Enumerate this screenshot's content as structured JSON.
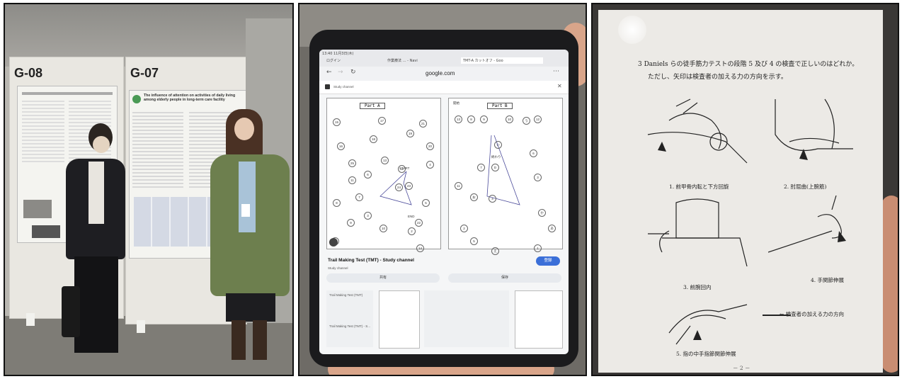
{
  "panel_left": {
    "boards": [
      {
        "label": "G-08"
      },
      {
        "label": "G-07"
      }
    ],
    "poster_title": "The influence of attention on activities of daily living among elderly people in long-term care facility"
  },
  "panel_middle": {
    "browser": {
      "time": "13:40  11月3日(木)",
      "tabs": [
        "ログイン",
        "作業療法 … - Navi",
        "TMT-A カットオフ - Goo"
      ],
      "url": "google.com",
      "channel_bar": "Study channel"
    },
    "sheets": [
      {
        "label": "Part A",
        "numbers": [
          "15",
          "17",
          "21",
          "16",
          "19",
          "13",
          "12",
          "6",
          "4",
          "23",
          "5",
          "24",
          "8",
          "7",
          "3",
          "9",
          "10",
          "2",
          "1",
          "14",
          "25",
          "11",
          "20",
          "22",
          "18"
        ],
        "start_text": "START",
        "end_text": "END"
      },
      {
        "label": "Part B",
        "numbers": [
          "13",
          "8",
          "9",
          "10",
          "12",
          "い",
          "う",
          "D",
          "7",
          "3",
          "6",
          "11",
          "お",
          "あ",
          "え",
          "1",
          "2",
          "5",
          "4",
          "か"
        ],
        "start_text": "開始",
        "end_text": "終わり"
      }
    ],
    "video": {
      "title": "Trail Making Test (TMT) - Study channel",
      "subtitle": "Study channel",
      "subscribe": "登録",
      "share": "共有",
      "save": "保存"
    },
    "suggestion_title": "Trail Making Test (TMT)",
    "suggestion_sub": "Trail Making Test (TMT) - S..."
  },
  "panel_right": {
    "question_line1": "3  Daniels らの徒手筋力テストの段階 5 及び 4 の検査で正しいのはどれか。",
    "question_line2": "ただし、矢印は検査者の加える力の方向を示す。",
    "captions": [
      "1.  前甲骨内転と下方回旋",
      "2.  肘屈曲(上腕筋)",
      "3.  前腕回内",
      "4.  手関節伸展",
      "5.  指の中手指節関節伸展"
    ],
    "legend": "← 検査者の加える力の方向",
    "page_footer": "－ 2 －"
  }
}
